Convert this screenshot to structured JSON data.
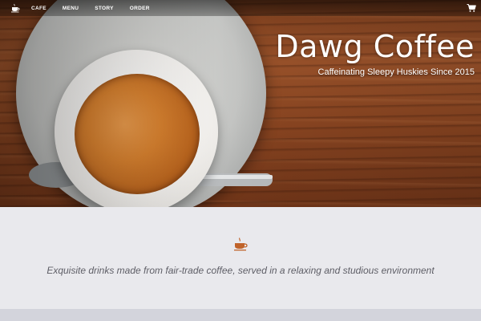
{
  "nav": {
    "logo_icon": "coffee-cup-icon",
    "links": [
      "CAFE",
      "MENU",
      "STORY",
      "ORDER"
    ],
    "cart_icon": "shopping-cart-icon"
  },
  "hero": {
    "title": "Dawg Coffee",
    "subtitle": "Caffeinating Sleepy Huskies Since 2015"
  },
  "main": {
    "icon": "coffee-cup-icon",
    "icon_color": "#c0632a",
    "tagline": "Exquisite drinks made from fair-trade coffee, served in a relaxing and studious environment"
  },
  "colors": {
    "accent": "#c0632a",
    "band": "#e9e9ed"
  }
}
